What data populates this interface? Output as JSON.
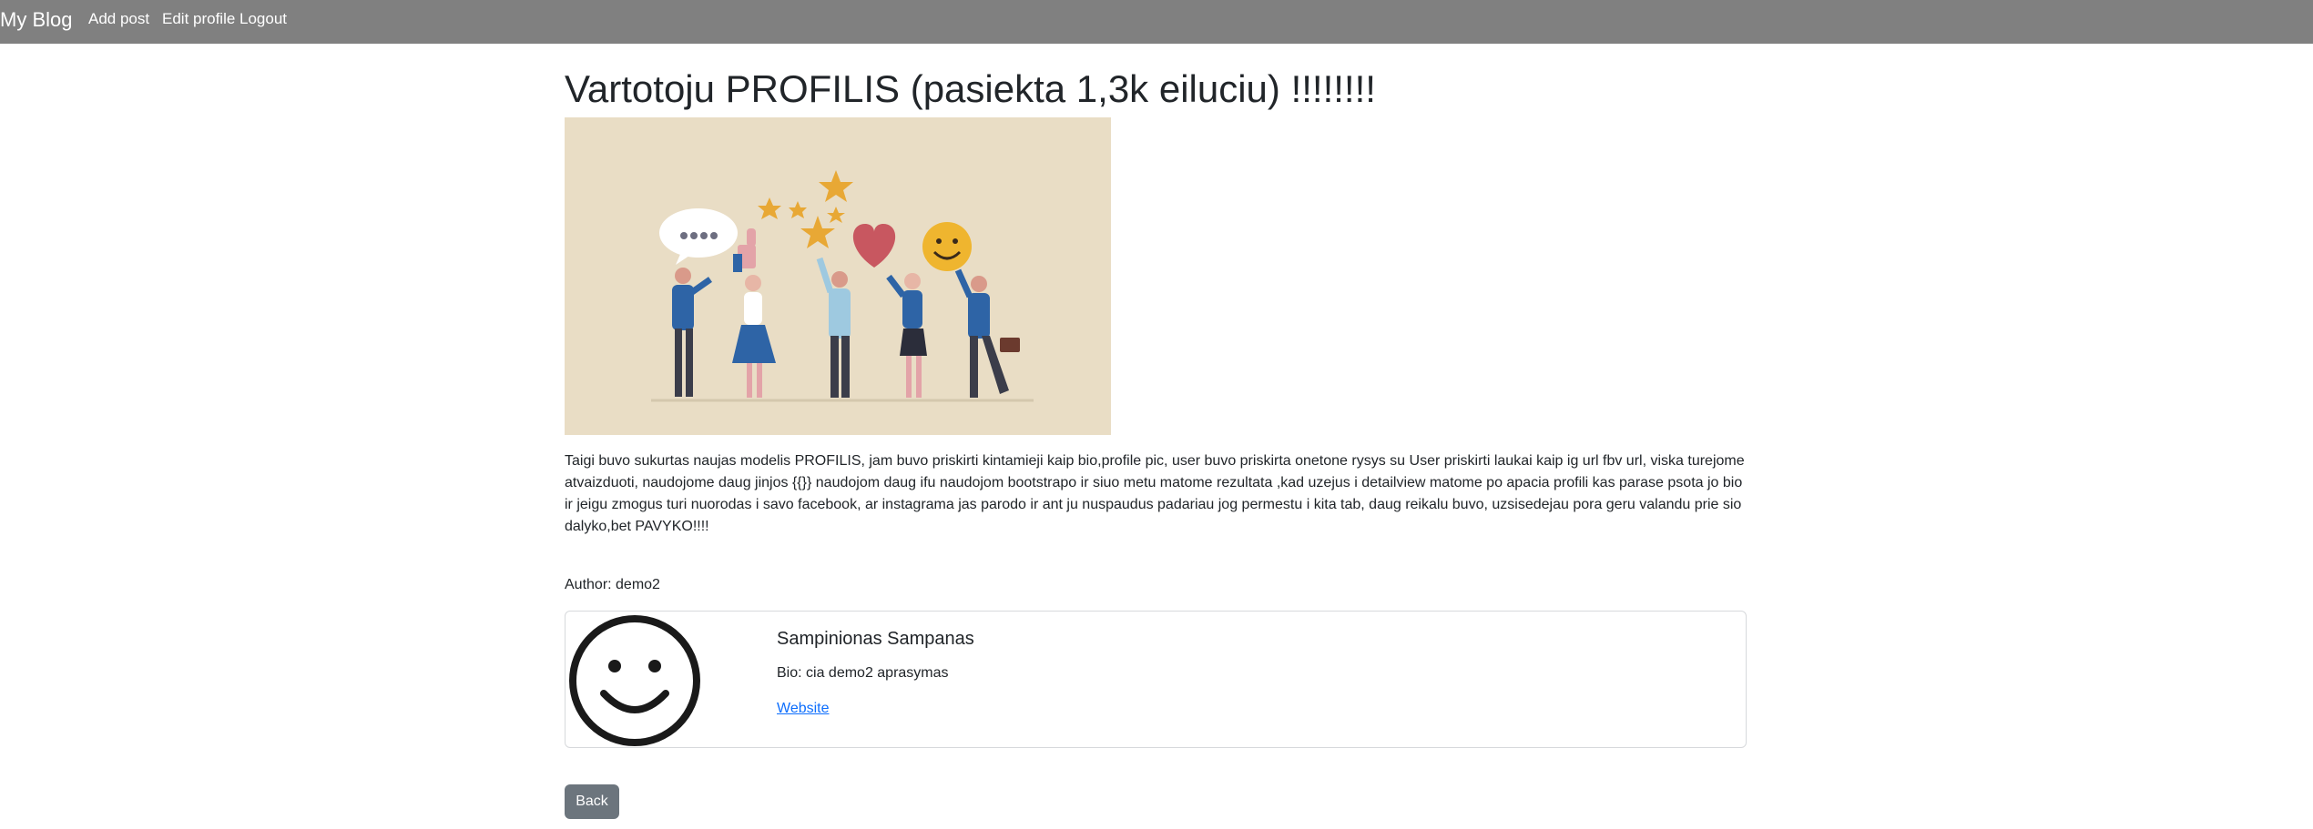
{
  "navbar": {
    "brand": "My Blog",
    "links": [
      "Add post",
      "Edit profile",
      "Logout"
    ]
  },
  "post": {
    "title": "Vartotoju PROFILIS (pasiekta 1,3k eiluciu) !!!!!!!!",
    "image": "people-feedback-illustration",
    "body": "Taigi buvo sukurtas naujas modelis PROFILIS, jam buvo priskirti kintamieji kaip bio,profile pic, user buvo priskirta onetone rysys su User priskirti laukai kaip ig url fbv url, viska turejome atvaizduoti, naudojome daug jinjos {{}} naudojom daug ifu naudojom bootstrapo ir siuo metu matome rezultata ,kad uzejus i detailview matome po apacia profili kas parase psota jo bio ir jeigu zmogus turi nuorodas i savo facebook, ar instagrama jas parodo ir ant ju nuspaudus padariau jog permestu i kita tab, daug reikalu buvo, uzsisedejau pora geru valandu prie sio dalyko,bet PAVYKO!!!!",
    "author_label": "Author: demo2"
  },
  "profile_card": {
    "avatar_icon": "smiley-face-icon",
    "name": "Sampinionas Sampanas",
    "bio": "Bio: cia demo2 aprasymas",
    "website_label": "Website"
  },
  "actions": {
    "back_label": "Back"
  },
  "colors": {
    "navbar_bg": "#808080",
    "link": "#0d6efd",
    "button_secondary": "#6c757d",
    "hero_bg": "#e9ddc5"
  }
}
